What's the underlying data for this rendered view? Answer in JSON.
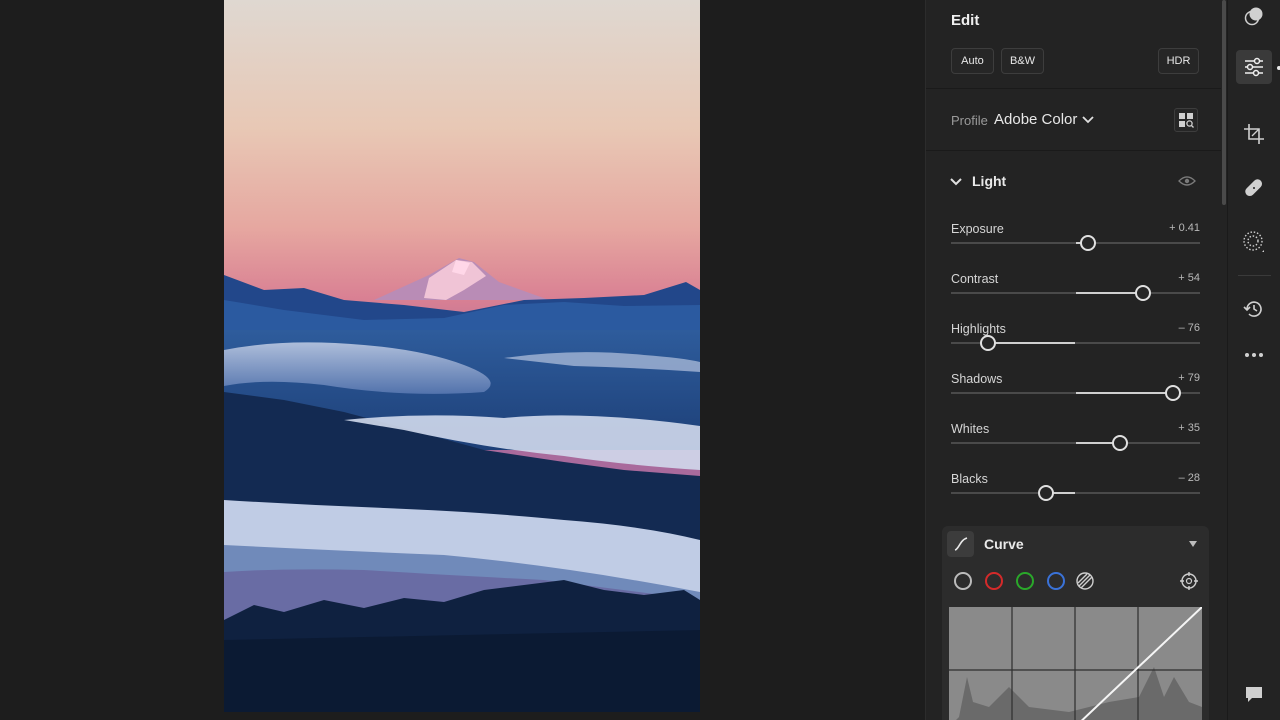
{
  "edit_panel": {
    "title": "Edit",
    "buttons": {
      "auto": "Auto",
      "bw": "B&W",
      "hdr": "HDR"
    },
    "profile": {
      "label": "Profile",
      "value": "Adobe Color"
    },
    "light_section": {
      "title": "Light",
      "sliders": [
        {
          "label": "Exposure",
          "value": "+ 0.41",
          "position": 0.55
        },
        {
          "label": "Contrast",
          "value": "+ 54",
          "position": 0.77
        },
        {
          "label": "Highlights",
          "value": "– 76",
          "position": 0.15
        },
        {
          "label": "Shadows",
          "value": "+ 79",
          "position": 0.89
        },
        {
          "label": "Whites",
          "value": "+ 35",
          "position": 0.68
        },
        {
          "label": "Blacks",
          "value": "– 28",
          "position": 0.38
        }
      ]
    },
    "curve": {
      "title": "Curve",
      "channels": [
        {
          "name": "rgb-channel",
          "color": "#bbbbbb"
        },
        {
          "name": "red-channel",
          "color": "#d42a2a"
        },
        {
          "name": "green-channel",
          "color": "#2aa82a"
        },
        {
          "name": "blue-channel",
          "color": "#3a72d8"
        }
      ]
    }
  },
  "toolstrip": {
    "items": [
      "presets-icon",
      "edit-sliders-icon",
      "crop-icon",
      "healing-icon",
      "masking-icon",
      "history-icon",
      "more-icon",
      "comments-icon"
    ],
    "active": "edit-sliders-icon"
  },
  "colors": {
    "panel_bg": "#232323",
    "app_bg": "#1d1d1d",
    "accent": "#e0e0e0"
  }
}
